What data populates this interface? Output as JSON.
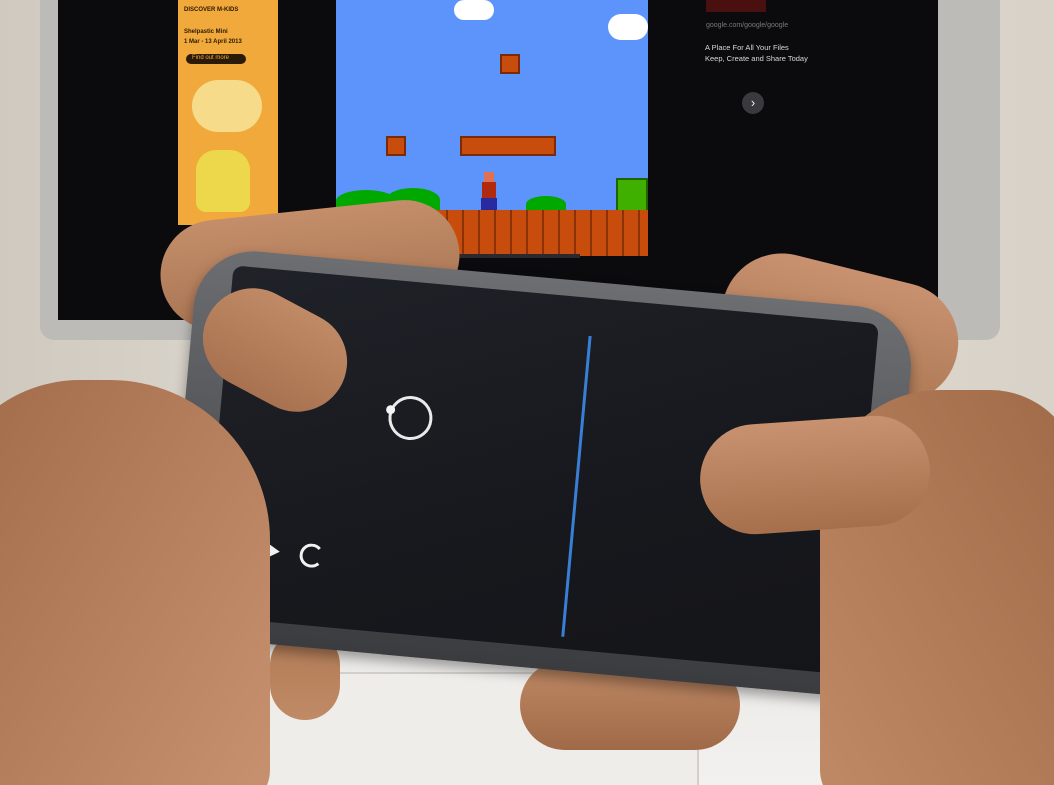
{
  "left_ad": {
    "line1": "DISCOVER M-KIDS",
    "line2": "Shelpastic Mini",
    "line3": "1 Mar - 13 April 2013",
    "button": "Find out more"
  },
  "right_ad": {
    "url": "google.com/google/google",
    "text": "A Place For All Your Files Keep, Create and Share Today",
    "arrow": "›"
  },
  "phone_controls": {
    "play_icon": "play-icon",
    "reload_icon": "reload-icon",
    "joystick": "joystick-ring",
    "divider_color": "#3a7fd6"
  },
  "colors": {
    "sky": "#5c94fc",
    "brick": "#c84c0c",
    "ad_orange": "#f0a93a"
  }
}
